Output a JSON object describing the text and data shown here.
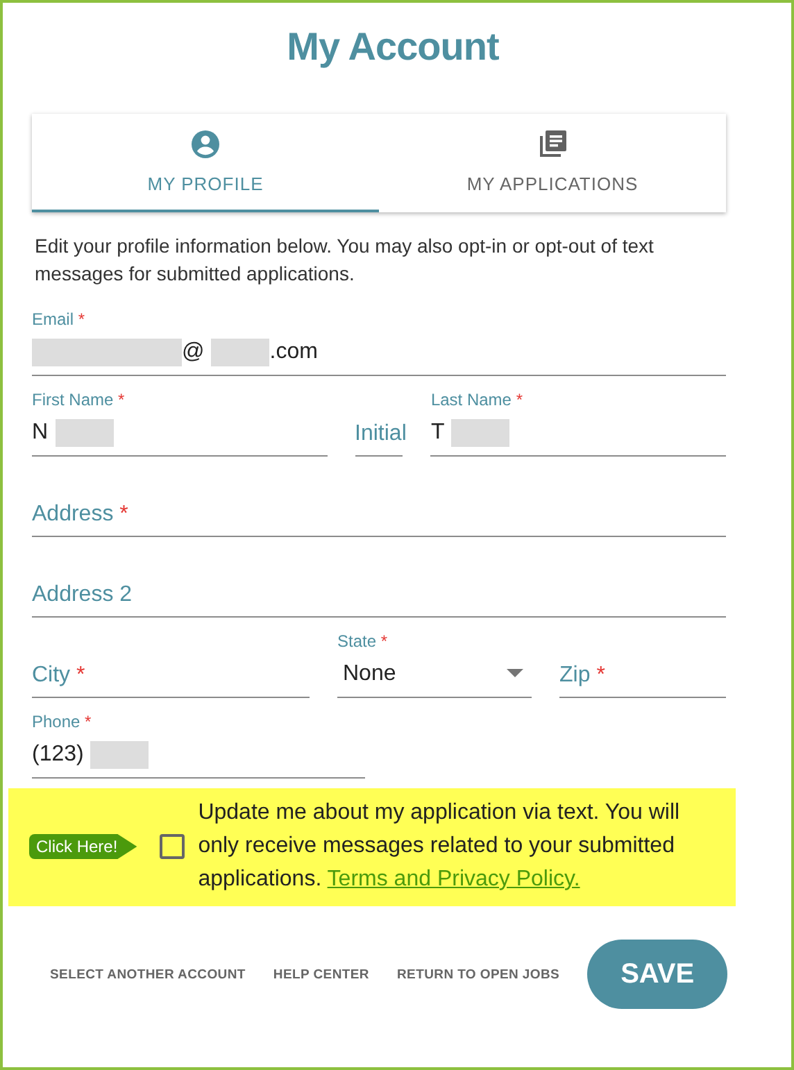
{
  "title": "My Account",
  "tabs": [
    {
      "label": "MY PROFILE",
      "selected": true
    },
    {
      "label": "MY APPLICATIONS",
      "selected": false
    }
  ],
  "intro": "Edit your profile information below. You may also opt-in or opt-out of text messages for submitted applications.",
  "form_rows": [
    [
      {
        "kind": "text",
        "label": "Email",
        "mark": "*",
        "value_parts": [
          {
            "kind": "redacted"
          },
          {
            "kind": "text",
            "text": "@"
          },
          {
            "kind": "redacted"
          },
          {
            "kind": "text",
            "text": ".com"
          }
        ]
      }
    ],
    [
      {
        "kind": "text",
        "label": "First Name",
        "mark": "*",
        "value_parts": [
          {
            "kind": "text",
            "text": "N"
          },
          {
            "kind": "redacted"
          }
        ]
      },
      {
        "kind": "text",
        "label": "Initial"
      },
      {
        "kind": "text",
        "label": "Last Name",
        "mark": "*",
        "value_parts": [
          {
            "kind": "text",
            "text": "T"
          },
          {
            "kind": "redacted"
          }
        ]
      }
    ],
    [
      {
        "kind": "text",
        "label": "Address",
        "mark": "*"
      }
    ],
    [
      {
        "kind": "text",
        "label": "Address 2"
      }
    ],
    [
      {
        "kind": "text",
        "label": "City",
        "mark": "*"
      },
      {
        "kind": "select",
        "label": "State",
        "mark": "*",
        "value_parts": [
          {
            "kind": "text",
            "text": "None"
          }
        ]
      },
      {
        "kind": "text",
        "label": "Zip",
        "mark": "*"
      }
    ],
    [
      {
        "kind": "phone",
        "label": "Phone",
        "mark": "*",
        "value_parts": [
          {
            "kind": "text",
            "text": "(123)"
          },
          {
            "kind": "redacted"
          }
        ]
      }
    ]
  ],
  "sms_optin": {
    "tag": "Click Here!",
    "checked": false,
    "text": "Update me about my application via text. You will only receive messages related to your submitted applications.",
    "link": "Terms and Privacy Policy."
  },
  "footer_links": [
    "SELECT ANOTHER ACCOUNT",
    "HELP CENTER",
    "RETURN TO OPEN JOBS"
  ],
  "save_button": "SAVE"
}
